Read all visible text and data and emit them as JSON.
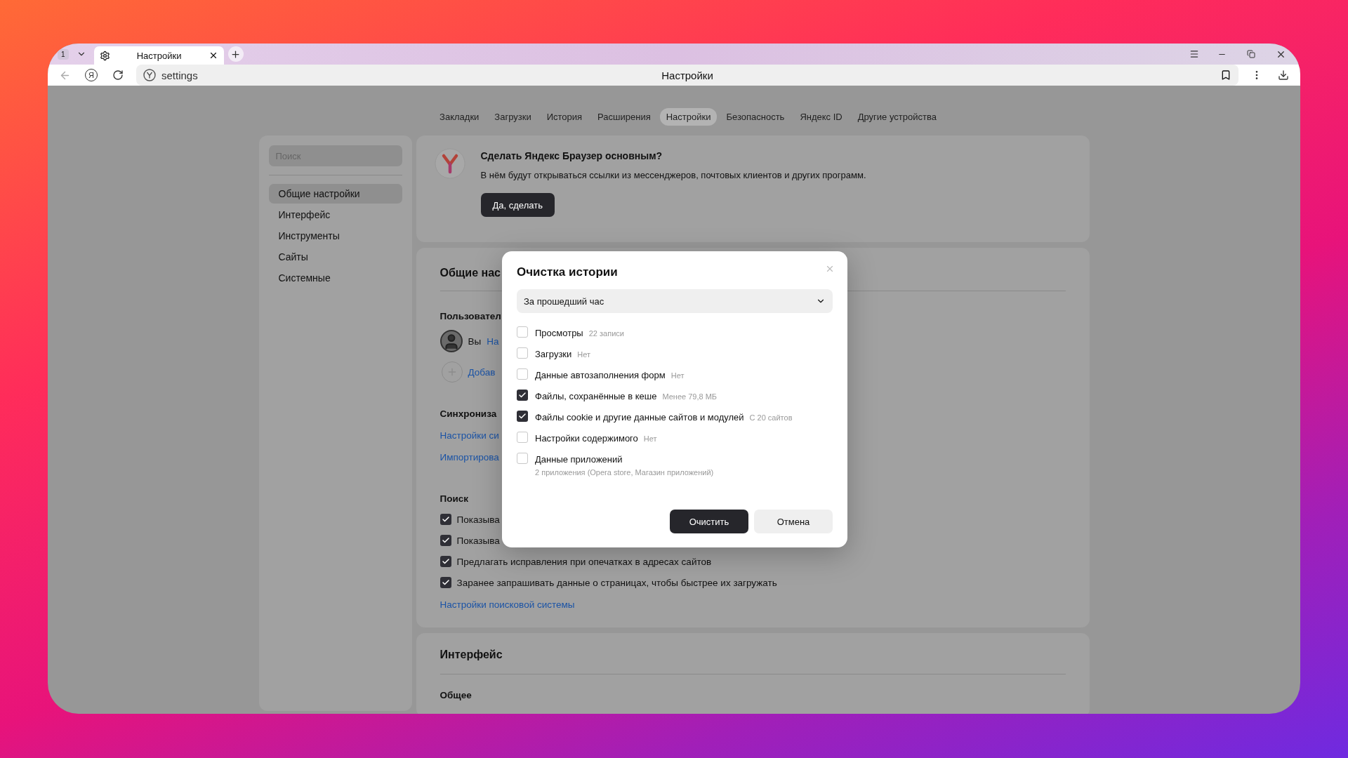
{
  "browser": {
    "tab_counter": "1",
    "tab_title": "Настройки",
    "account_glyph": "Я",
    "address": "settings",
    "page_title": "Настройки"
  },
  "nav_tabs": [
    {
      "label": "Закладки",
      "selected": false
    },
    {
      "label": "Загрузки",
      "selected": false
    },
    {
      "label": "История",
      "selected": false
    },
    {
      "label": "Расширения",
      "selected": false
    },
    {
      "label": "Настройки",
      "selected": true
    },
    {
      "label": "Безопасность",
      "selected": false
    },
    {
      "label": "Яндекс ID",
      "selected": false
    },
    {
      "label": "Другие устройства",
      "selected": false
    }
  ],
  "sidebar": {
    "search_placeholder": "Поиск",
    "items": [
      {
        "label": "Общие настройки",
        "selected": true
      },
      {
        "label": "Интерфейс",
        "selected": false
      },
      {
        "label": "Инструменты",
        "selected": false
      },
      {
        "label": "Сайты",
        "selected": false
      },
      {
        "label": "Системные",
        "selected": false
      }
    ]
  },
  "banner": {
    "title": "Сделать Яндекс Браузер основным?",
    "text": "В нём будут открываться ссылки из мессенджеров, почтовых клиентов и других программ.",
    "button": "Да, сделать"
  },
  "general_card": {
    "heading": "Общие нас",
    "users_heading": "Пользовател",
    "user_name": "Вы",
    "user_link": "На",
    "add_link": "Добав",
    "sync_heading": "Синхрониза",
    "sync_links": [
      "Настройки си",
      "Импортирова"
    ],
    "search_heading": "Поиск",
    "search_options": [
      {
        "label": "Показыва",
        "checked": true
      },
      {
        "label": "Показыва",
        "checked": true
      },
      {
        "label": "Предлагать исправления при опечатках в адресах сайтов",
        "checked": true
      },
      {
        "label": "Заранее запрашивать данные о страницах, чтобы быстрее их загружать",
        "checked": true
      }
    ],
    "search_link": "Настройки поисковой системы"
  },
  "interface_card": {
    "heading": "Интерфейс",
    "subheading": "Общее"
  },
  "dialog": {
    "title": "Очистка истории",
    "period": "За прошедший час",
    "options": [
      {
        "label": "Просмотры",
        "detail": "22 записи",
        "checked": false
      },
      {
        "label": "Загрузки",
        "detail": "Нет",
        "checked": false
      },
      {
        "label": "Данные автозаполнения форм",
        "detail": "Нет",
        "checked": false
      },
      {
        "label": "Файлы, сохранённые в кеше",
        "detail": "Менее 79,8 МБ",
        "checked": true
      },
      {
        "label": "Файлы cookie и другие данные сайтов и модулей",
        "detail": "С 20 сайтов",
        "checked": true
      },
      {
        "label": "Настройки содержимого",
        "detail": "Нет",
        "checked": false
      },
      {
        "label": "Данные приложений",
        "note": "2 приложения (Opera store, Магазин приложений)",
        "checked": false
      }
    ],
    "primary_button": "Очистить",
    "secondary_button": "Отмена"
  }
}
